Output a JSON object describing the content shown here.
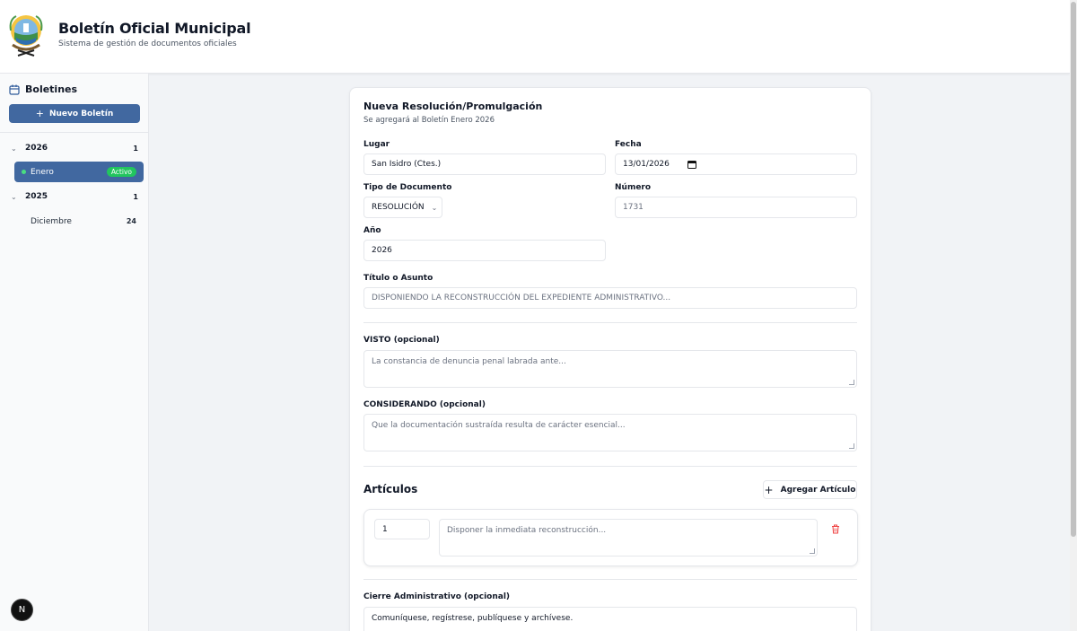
{
  "header": {
    "title": "Boletín Oficial Municipal",
    "subtitle": "Sistema de gestión de documentos oficiales"
  },
  "sidebar": {
    "heading": "Boletines",
    "new_button": "Nuevo Boletín",
    "years": [
      {
        "year": "2026",
        "count": "1",
        "months": [
          {
            "name": "Enero",
            "badge": "Activo",
            "active": true
          }
        ]
      },
      {
        "year": "2025",
        "count": "1",
        "months": [
          {
            "name": "Diciembre",
            "count": "24",
            "active": false
          }
        ]
      }
    ]
  },
  "form": {
    "title": "Nueva Resolución/Promulgación",
    "subtitle": "Se agregará al Boletín Enero 2026",
    "lugar": {
      "label": "Lugar",
      "value": "San Isidro (Ctes.)"
    },
    "fecha": {
      "label": "Fecha",
      "value": "13/01/2026"
    },
    "tipo": {
      "label": "Tipo de Documento",
      "value": "RESOLUCIÓN"
    },
    "numero": {
      "label": "Número",
      "placeholder": "1731"
    },
    "anio": {
      "label": "Año",
      "value": "2026"
    },
    "titulo": {
      "label": "Título o Asunto",
      "placeholder": "DISPONIENDO LA RECONSTRUCCIÓN DEL EXPEDIENTE ADMINISTRATIVO..."
    },
    "visto": {
      "label": "VISTO (opcional)",
      "placeholder": "La constancia de denuncia penal labrada ante..."
    },
    "considerando": {
      "label": "CONSIDERANDO (opcional)",
      "placeholder": "Que la documentación sustraída resulta de carácter esencial..."
    },
    "articulos": {
      "title": "Artículos",
      "add_button": "Agregar Artículo",
      "items": [
        {
          "number": "1",
          "placeholder": "Disponer la inmediata reconstrucción..."
        }
      ]
    },
    "cierre": {
      "label": "Cierre Administrativo (opcional)",
      "value": "Comuníquese, regístrese, publíquese y archívese."
    }
  },
  "misc": {
    "avatar_letter": "N"
  },
  "colors": {
    "primary": "#4168a0",
    "active_badge": "#22c55e",
    "danger": "#ef4444"
  }
}
